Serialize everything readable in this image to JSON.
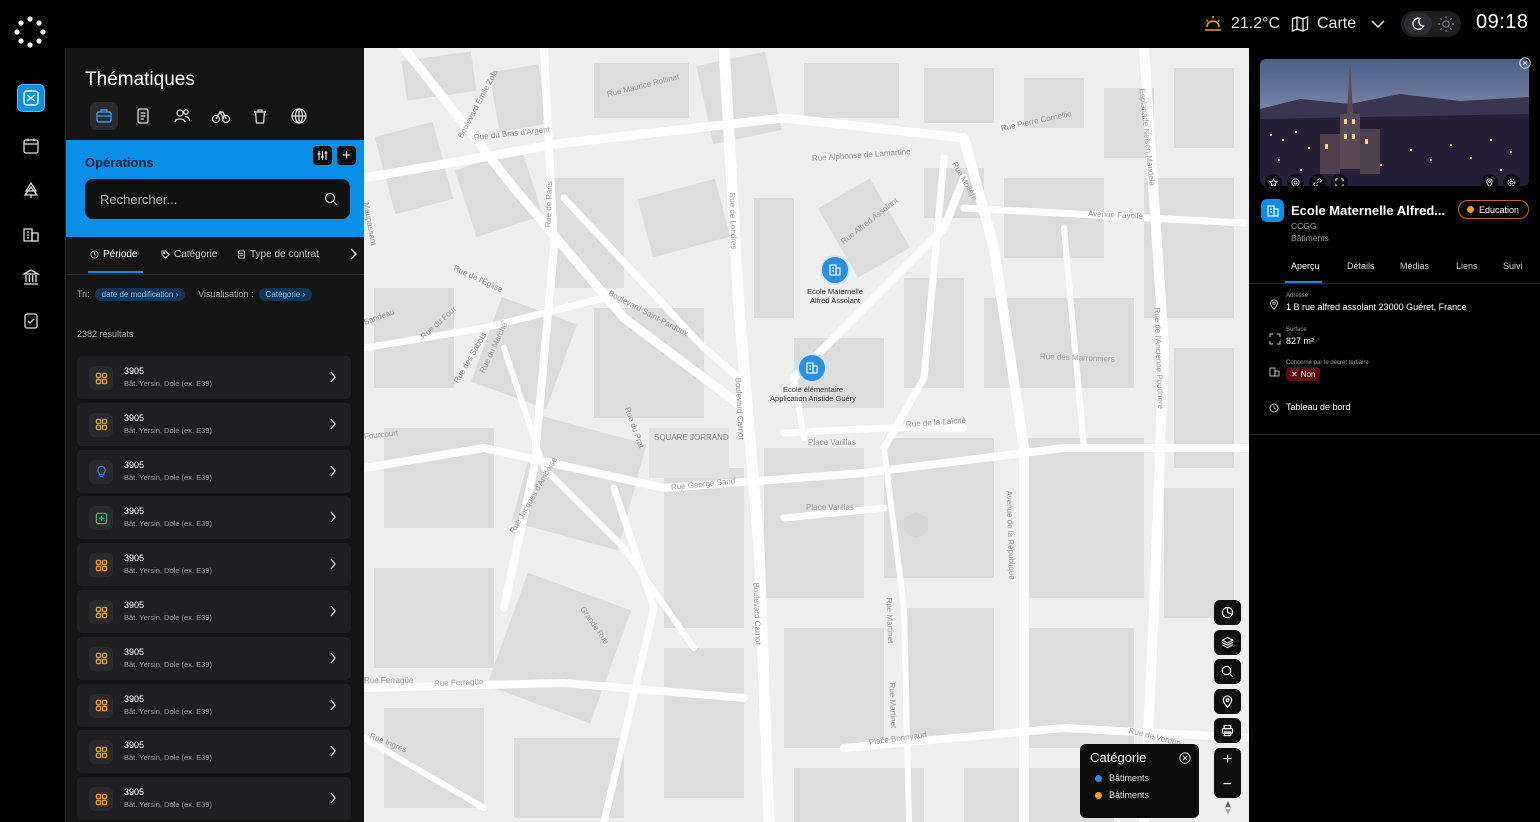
{
  "topbar": {
    "weather_icon": "sun-icon",
    "temperature": "21.2°C",
    "view_icon": "map-icon",
    "view_label": "Carte",
    "theme_icons": [
      "moon-icon",
      "sun-icon"
    ],
    "time": "09:18"
  },
  "rail": {
    "items": [
      "operations-icon",
      "calendar-icon",
      "tree-icon",
      "building-icon",
      "institution-icon",
      "report-icon"
    ],
    "active": "operations-icon"
  },
  "left_panel": {
    "title": "Thématiques",
    "theme_tabs": [
      "briefcase-icon",
      "document-icon",
      "users-icon",
      "bicycle-icon",
      "trash-icon",
      "grid-globe-icon"
    ],
    "section": {
      "title": "Opérations",
      "filter_icon": "sliders-icon",
      "add_label": "+"
    },
    "search": {
      "placeholder": "Rechercher..."
    },
    "subtabs": [
      {
        "label": "Période",
        "icon": "clock-icon"
      },
      {
        "label": "Catégorie",
        "icon": "tag-icon"
      },
      {
        "label": "Type de contrat",
        "icon": "file-icon"
      }
    ],
    "sort_label": "Tri:",
    "sort_value": "date de modification",
    "visualisation_label": "Visualisation :",
    "visualisation_value": "Catégorie",
    "results": "2382 résultats",
    "items": [
      {
        "title": "3905",
        "subtitle": "Bât. Yersin, Dole (ex. E39)",
        "icon": "grid-icon",
        "color": "#f5a000"
      },
      {
        "title": "3905",
        "subtitle": "Bât. Yersin, Dole (ex. E39)",
        "icon": "grid-icon",
        "color": "#f5a000"
      },
      {
        "title": "3905",
        "subtitle": "Bât. Yersin, Dole (ex. E39)",
        "icon": "bulb-icon",
        "color": "#3b7fd9"
      },
      {
        "title": "3905",
        "subtitle": "Bât. Yersin, Dole (ex. E39)",
        "icon": "plus-box-icon",
        "color": "#1fbf76"
      },
      {
        "title": "3905",
        "subtitle": "Bât. Yersin, Dole (ex. E39)",
        "icon": "grid-icon",
        "color": "#f5a000"
      },
      {
        "title": "3905",
        "subtitle": "Bât. Yersin, Dole (ex. E39)",
        "icon": "grid-icon",
        "color": "#f5a000"
      },
      {
        "title": "3905",
        "subtitle": "Bât. Yersin, Dole (ex. E39)",
        "icon": "grid-icon",
        "color": "#f5a000"
      },
      {
        "title": "3905",
        "subtitle": "Bât. Yersin, Dole (ex. E39)",
        "icon": "grid-icon",
        "color": "#f5a000"
      },
      {
        "title": "3905",
        "subtitle": "Bât. Yersin, Dole (ex. E39)",
        "icon": "grid-icon",
        "color": "#f5a000"
      },
      {
        "title": "3905",
        "subtitle": "Bât. Yersin, Dole (ex. E39)",
        "icon": "grid-icon",
        "color": "#f5a000"
      }
    ]
  },
  "map": {
    "streets": [
      "Rue du Bras d'Argent",
      "Rue Maurice Rollinat",
      "Boulevard Emile Zola",
      "Rue de Paris",
      "Rue Alphonse de Lamartine",
      "Rue Pierre Cornellie",
      "Esplanade Nelson Mandela",
      "Avenue Fayolle",
      "Rue Alfred Assolant",
      "Rue Molière",
      "Rue de l'Église",
      "Rue du Four",
      "Boulevard Saint-Pardoux",
      "Rue de Londres",
      "Rue du Prat",
      "Rue des Marronniers",
      "Rue de l'Ancienne Poudrière",
      "Rue de la Laïcité",
      "Place Varillas",
      "Place Varillas",
      "SQUARE JORRAND",
      "Rue George Sand",
      "Boulevard Carnot",
      "Avenue de la République",
      "Rue Ferragüe",
      "Rue Ferragüe",
      "Grande Rue",
      "Rue Martinet",
      "Place Bonnyaud",
      "Rue de Verdun",
      "Rue des Sabots",
      "Rue du Marché",
      "Rue Jacques d'Amboise",
      "Rue Ingres",
      "Sandeau",
      "Maupassant",
      "Boulevard Carnot",
      "Rue Martinet",
      "Fourcourt"
    ],
    "markers": [
      {
        "label_line1": "Ecole Maternelle",
        "label_line2": "Alfred Assolant",
        "icon": "building-icon"
      },
      {
        "label_line1": "Ecole élémentaire",
        "label_line2": "Application Aristide Guéry",
        "icon": "building-icon"
      }
    ],
    "tools": [
      "pie-chart-icon",
      "layers-icon",
      "search-icon",
      "pin-icon",
      "printer-icon"
    ],
    "zoom_in": "+",
    "zoom_out": "−",
    "compass_icon": "compass-icon",
    "legend": {
      "title": "Catégorie",
      "items": [
        {
          "label": "Bâtiments",
          "color": "#2b8fe0"
        },
        {
          "label": "Bâtiments",
          "color": "#f5a000"
        }
      ]
    }
  },
  "detail": {
    "title": "Ecole Maternelle Alfred...",
    "category_badge": "Education",
    "badge_color": "#f5a000",
    "subtitle1": "CCGG",
    "subtitle2": "Bâtiments",
    "tabs": [
      "Aperçu",
      "Détails",
      "Médias",
      "Liens",
      "Suivi"
    ],
    "active_tab": "Aperçu",
    "hero_buttons": [
      "star-icon",
      "target-icon",
      "link-icon",
      "expand-icon",
      "pin-icon",
      "settings-icon"
    ],
    "address_label": "Adresse",
    "address": "1 B rue alfred assolant 23000 Guéret, France",
    "surface_label": "Surface",
    "surface": "827 m²",
    "decret_label": "Concerné par le décret tertiaire",
    "decret_value": "Non",
    "dashboard_label": "Tableau de bord"
  }
}
